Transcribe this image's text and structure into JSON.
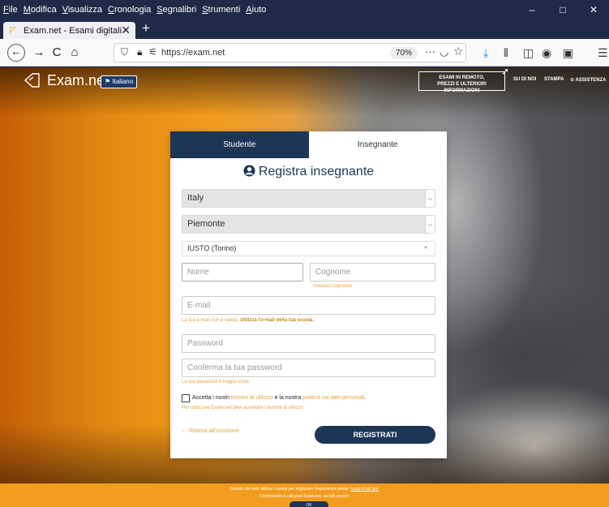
{
  "browser": {
    "menu": [
      {
        "u": "F",
        "rest": "ile"
      },
      {
        "u": "M",
        "rest": "odifica"
      },
      {
        "u": "V",
        "rest": "isualizza"
      },
      {
        "u": "C",
        "rest": "ronologia"
      },
      {
        "u": "S",
        "rest": "egnalibri"
      },
      {
        "u": "S",
        "rest": "trumenti"
      },
      {
        "u": "A",
        "rest": "iuto"
      }
    ],
    "window_controls": {
      "minimize": "–",
      "maximize": "□",
      "close": "✕"
    },
    "tab": {
      "title": "Exam.net - Esami digitali",
      "close": "✕"
    },
    "new_tab": "+",
    "nav": {
      "back": "←",
      "forward": "→",
      "reload": "C",
      "home": "⌂"
    },
    "urlbar": {
      "url": "https://exam.net",
      "zoom": "70%",
      "more": "···"
    }
  },
  "site": {
    "logo_text": "Exam.net",
    "language": "Italiano",
    "remote_line1": "ESAMI IN REMOTO,",
    "remote_line2": "PREZZI E ULTERIORI INFORMAZIONI",
    "nav_about": "SU DI NOI",
    "nav_print": "STAMPA",
    "nav_help": "⊙ ASSISTENZA"
  },
  "form": {
    "tab_student": "Studente",
    "tab_teacher": "Insegnante",
    "title": "Registra insegnante",
    "country": "Italy",
    "region": "Piemonte",
    "school": "IUSTO (Torino)",
    "first_name_placeholder": "Nome",
    "last_name_placeholder": "Cognome",
    "last_name_hint": "Inserisci cognome",
    "email_placeholder": "E-mail",
    "email_hint": "La tua e-mail non è valida.",
    "email_hint_bold": "Utilizza l'e-mail della tua scuola.",
    "password_placeholder": "Password",
    "confirm_placeholder": "Conferma la tua password",
    "password_hint": "La tua password è troppo corta.",
    "terms_a": "Accetta i nostri",
    "terms_link1": "termini di utilizzo",
    "terms_b": "e la nostra",
    "terms_link2": "politica sui dati personali",
    "terms_end": ".",
    "terms_hint": "Per utilizzare Exam.net devi accettare i termini di utilizzo",
    "back_link": "← Ritorna all'iscrizione",
    "submit": "REGISTRATI"
  },
  "cookie": {
    "line1": "Questo sito web utilizza i cookie per migliorare l'esperienza utente.",
    "line1_link": "Leggi di più qui.",
    "line2": "Continuando a utilizzare Exam.net, accetti questo.",
    "ok": "OK"
  }
}
